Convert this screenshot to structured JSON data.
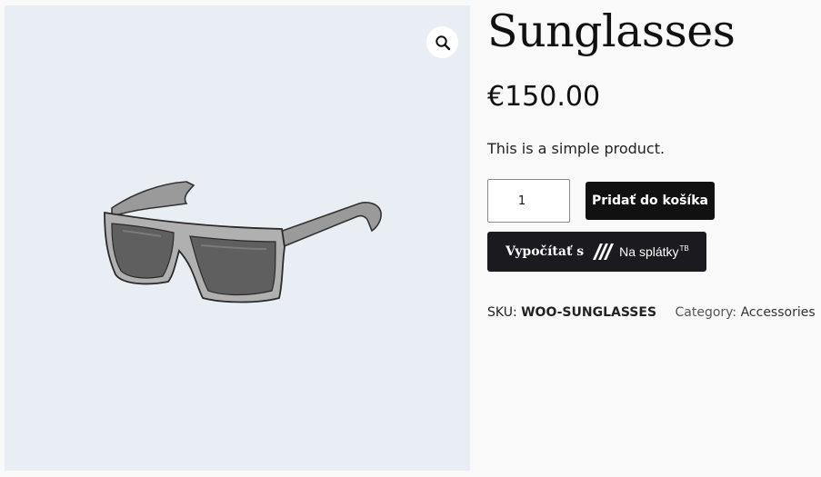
{
  "gallery": {
    "zoom_icon": "magnifier-icon",
    "image_alt": "Sunglasses"
  },
  "product": {
    "title": "Sunglasses",
    "price": "€150.00",
    "short_description": "This is a simple product.",
    "quantity": "1",
    "add_to_cart_label": "Pridať do košíka",
    "calc_button": {
      "prefix": "Vypočítať s",
      "suffix": "Na splátky",
      "suffix_sup": "TB"
    },
    "meta": {
      "sku_label": "SKU:",
      "sku_value": "WOO-SUNGLASSES",
      "category_label": "Category:",
      "category_value": "Accessories"
    }
  },
  "colors": {
    "gallery_bg": "#e8eef4",
    "button_bg": "#111111",
    "page_bg": "#f9f9f9"
  }
}
